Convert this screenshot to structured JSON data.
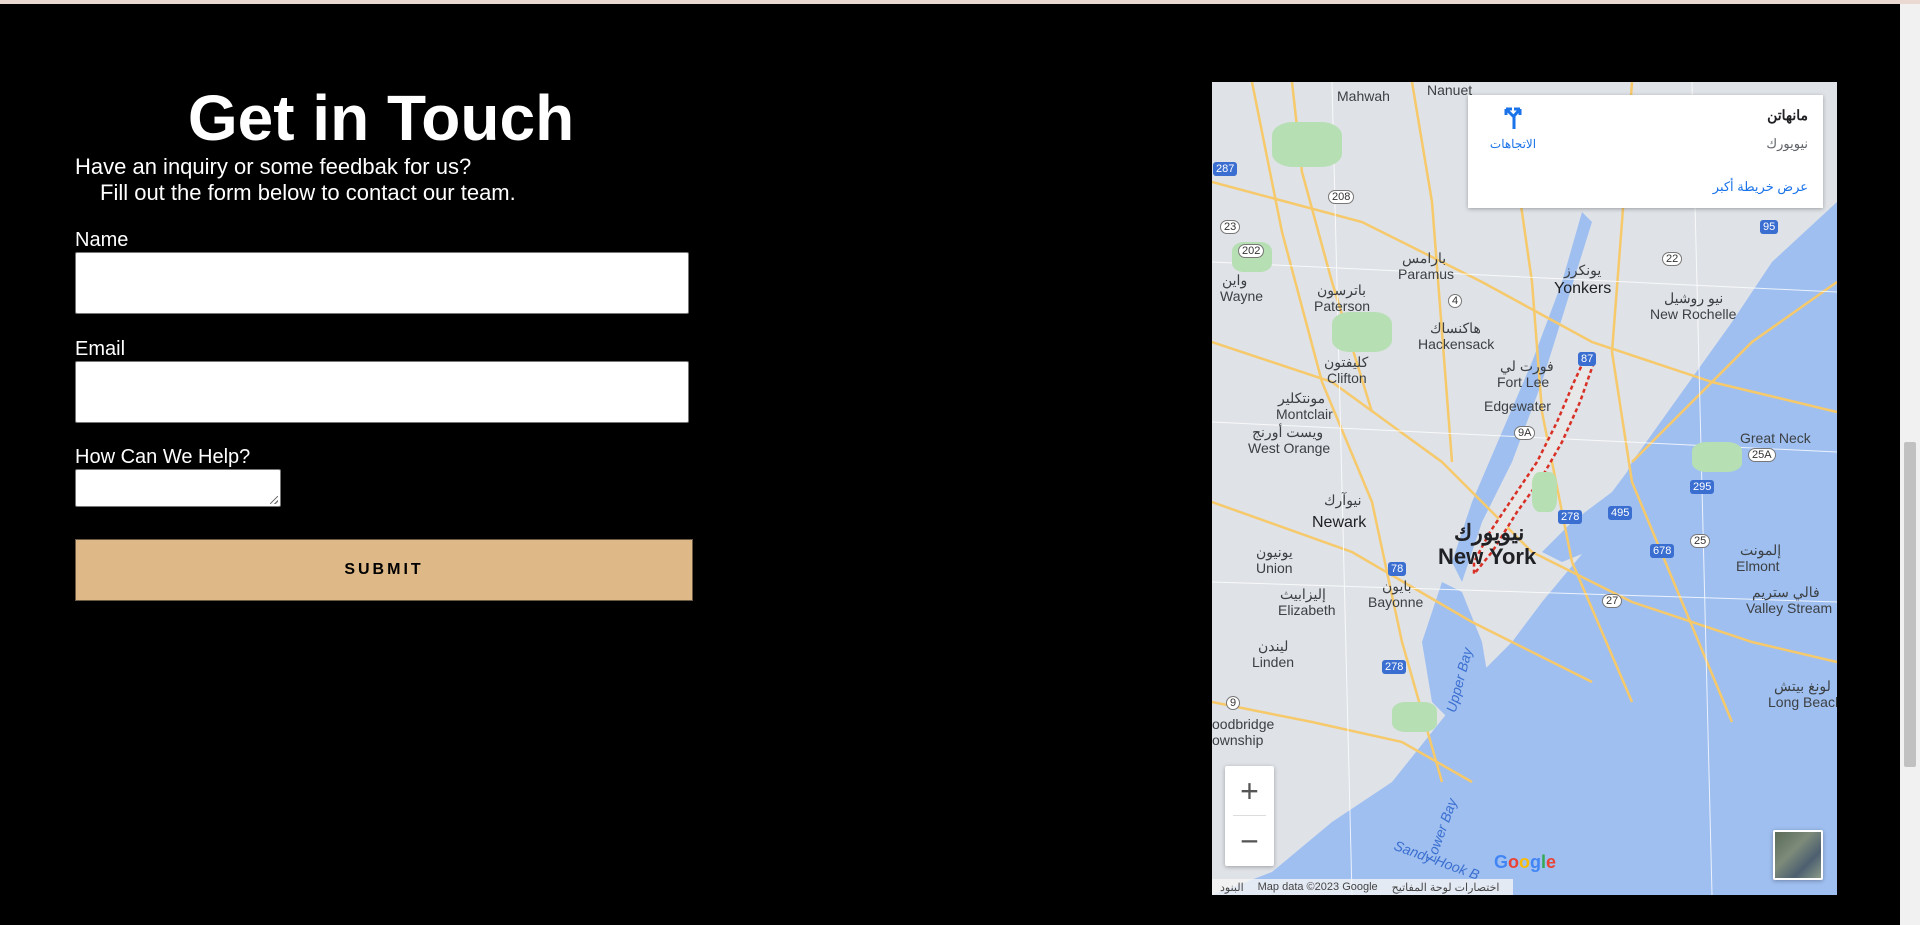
{
  "page": {
    "title": "Get in Touch",
    "intro_line1": "Have an inquiry or some feedbak for us?",
    "intro_line2": "Fill out the form below to contact our team."
  },
  "form": {
    "name_label": "Name",
    "name_value": "",
    "email_label": "Email",
    "email_value": "",
    "help_label": "How Can We Help?",
    "help_value": "",
    "submit_label": "SUBMIT",
    "button_color": "#deb887"
  },
  "map": {
    "card": {
      "title": "مانهاتن",
      "subtitle": "نيويورك",
      "directions_label": "الاتجاهات",
      "larger_map_link": "عرض خريطة أكبر"
    },
    "labels": {
      "new_york_ar": "نيويورك",
      "new_york": "New York",
      "yonkers_ar": "يونكرز",
      "yonkers": "Yonkers",
      "newark_ar": "نيوآرك",
      "newark": "Newark",
      "paterson_ar": "باترسون",
      "paterson": "Paterson",
      "hackensack_ar": "هاكنساك",
      "hackensack": "Hackensack",
      "clifton_ar": "كليفتون",
      "clifton": "Clifton",
      "montclair_ar": "مونتكلير",
      "montclair": "Montclair",
      "west_orange_ar": "ويست أورنج",
      "west_orange": "West Orange",
      "fort_lee_ar": "فورت لي",
      "fort_lee": "Fort Lee",
      "edgewater": "Edgewater",
      "paramus_ar": "بارامس",
      "paramus": "Paramus",
      "wayne_ar": "واين",
      "wayne": "Wayne",
      "mahwah": "Mahwah",
      "nanuet": "Nanuet",
      "new_rochelle_ar": "نيو روشيل",
      "new_rochelle": "New Rochelle",
      "great_neck": "Great Neck",
      "union_ar": "يونيون",
      "union": "Union",
      "elizabeth_ar": "إليزابيث",
      "elizabeth": "Elizabeth",
      "bayonne_ar": "بايون",
      "bayonne": "Bayonne",
      "linden_ar": "ليندن",
      "linden": "Linden",
      "elmont_ar": "إلمونت",
      "elmont": "Elmont",
      "valley_stream_ar": "فالي ستريم",
      "valley_stream": "Valley Stream",
      "long_beach_ar": "لونغ بيتش",
      "long_beach": "Long Beach",
      "woodbridge": "oodbridge",
      "township": "ownship",
      "upper_bay": "Upper Bay",
      "lower_bay": "Lower Bay",
      "sandy_hook": "Sandy Hook B"
    },
    "zoom_in": "+",
    "zoom_out": "−",
    "google_logo": "Google",
    "attribution": {
      "terms": "البنود",
      "map_data": "Map data ©2023 Google",
      "shortcuts": "اختصارات لوحة المفاتيح"
    },
    "colors": {
      "water": "#9fbff0",
      "land": "#dfe2e7",
      "park": "#b6dfb3",
      "road": "#f6c96b",
      "highlight": "#d93025"
    }
  }
}
